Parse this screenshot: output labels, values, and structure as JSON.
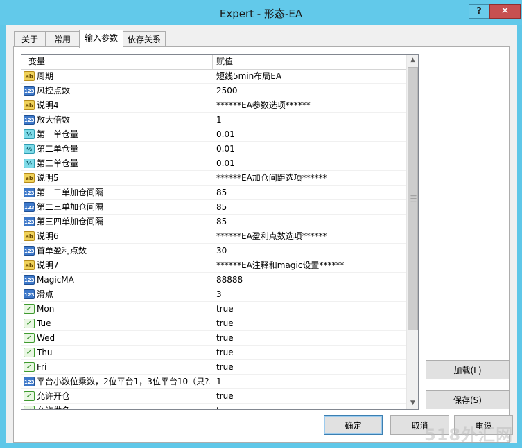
{
  "window": {
    "title": "Expert - 形态-EA",
    "help": "?",
    "close": "✕"
  },
  "tabs": [
    "关于",
    "常用",
    "输入参数",
    "依存关系"
  ],
  "table": {
    "col_variable": "变量",
    "col_value": "赋值",
    "rows": [
      {
        "icon": "ab",
        "name": "周期",
        "value": "短线5min布局EA"
      },
      {
        "icon": "123",
        "name": "风控点数",
        "value": "2500"
      },
      {
        "icon": "ab",
        "name": "说明4",
        "value": "******EA参数选项******"
      },
      {
        "icon": "123",
        "name": "放大倍数",
        "value": "1"
      },
      {
        "icon": "v2",
        "name": "第一单仓量",
        "value": "0.01"
      },
      {
        "icon": "v2",
        "name": "第二单仓量",
        "value": "0.01"
      },
      {
        "icon": "v2",
        "name": "第三单仓量",
        "value": "0.01"
      },
      {
        "icon": "ab",
        "name": "说明5",
        "value": "******EA加仓间距选项******"
      },
      {
        "icon": "123",
        "name": "第一二单加仓间隔",
        "value": "85"
      },
      {
        "icon": "123",
        "name": "第二三单加仓间隔",
        "value": "85"
      },
      {
        "icon": "123",
        "name": "第三四单加仓间隔",
        "value": "85"
      },
      {
        "icon": "ab",
        "name": "说明6",
        "value": "******EA盈利点数选项******"
      },
      {
        "icon": "123",
        "name": "首单盈利点数",
        "value": "30"
      },
      {
        "icon": "ab",
        "name": "说明7",
        "value": "******EA注释和magic设置******"
      },
      {
        "icon": "123",
        "name": "MagicMA",
        "value": "88888"
      },
      {
        "icon": "123",
        "name": "滑点",
        "value": "3"
      },
      {
        "icon": "bool",
        "name": "Mon",
        "value": "true"
      },
      {
        "icon": "bool",
        "name": "Tue",
        "value": "true"
      },
      {
        "icon": "bool",
        "name": "Wed",
        "value": "true"
      },
      {
        "icon": "bool",
        "name": "Thu",
        "value": "true"
      },
      {
        "icon": "bool",
        "name": "Fri",
        "value": "true"
      },
      {
        "icon": "123",
        "name": "平台小数位乘数，2位平台1，3位平台10（只?..",
        "value": "1"
      },
      {
        "icon": "bool",
        "name": "允许开仓",
        "value": "true"
      },
      {
        "icon": "bool",
        "name": "允许做多",
        "value": "t"
      }
    ]
  },
  "buttons": {
    "load": "加载(L)",
    "save": "保存(S)",
    "ok": "确定",
    "cancel": "取消",
    "reset": "重设"
  },
  "watermark": "518外汇网",
  "colors": {
    "titlebar": "#62c9ea",
    "close": "#c75050",
    "accent": "#3c7fb1"
  }
}
